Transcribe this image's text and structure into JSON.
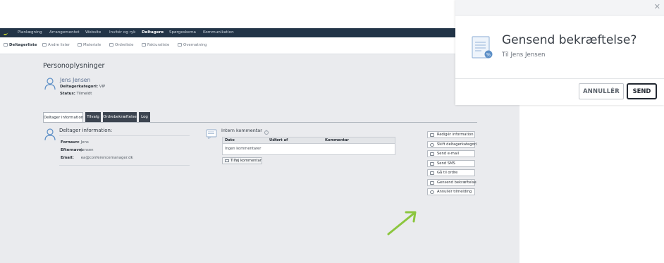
{
  "topnav": {
    "items": [
      "Planlægning",
      "Arrangementet",
      "Website",
      "Invitér og ryk",
      "Deltagere",
      "Spørgeskema",
      "Kommunikation"
    ],
    "active": "Deltagere"
  },
  "subnav": {
    "items": [
      "Deltagerliste",
      "Andre lister",
      "Materiale",
      "Ordreliste",
      "Fakturaliste",
      "Overnatning"
    ],
    "active": "Deltagerliste"
  },
  "person": {
    "page_title": "Personoplysninger",
    "name": "Jens Jensen",
    "category_label": "Deltagerkategori:",
    "category_value": "VIP",
    "status_label": "Status:",
    "status_value": "Tilmeldt"
  },
  "tabs": [
    "Deltager information",
    "Tilvalg",
    "Ordrebekræftelse",
    "Log"
  ],
  "info": {
    "title": "Deltager information:",
    "fields": [
      {
        "label": "Fornavn:",
        "value": "Jens"
      },
      {
        "label": "Efternavn:",
        "value": "Jensen"
      },
      {
        "label": "Email:",
        "value": "ea@conferencemanager.dk"
      }
    ]
  },
  "comment": {
    "title": "Intern kommentar",
    "help_glyph": "?",
    "columns": [
      "Dato",
      "Udført af",
      "Kommentar"
    ],
    "empty_text": "Ingen kommentarer",
    "add_label": "Tilføj kommentar"
  },
  "actions": [
    "Redigér information",
    "Skift deltagerkategori",
    "Send e-mail",
    "Send SMS",
    "Gå til ordre",
    "Gensend bekræftelse",
    "Annullér tilmelding"
  ],
  "modal": {
    "close_glyph": "✕",
    "title": "Gensend bekræftelse?",
    "subtitle": "Til Jens Jensen",
    "cancel_label": "ANNULLÉR",
    "send_label": "SEND"
  },
  "colors": {
    "topnav_bg": "#223447",
    "accent_arrow": "#8cc63f",
    "logo": "#c8d92e",
    "panel_bg": "#eaebee"
  }
}
